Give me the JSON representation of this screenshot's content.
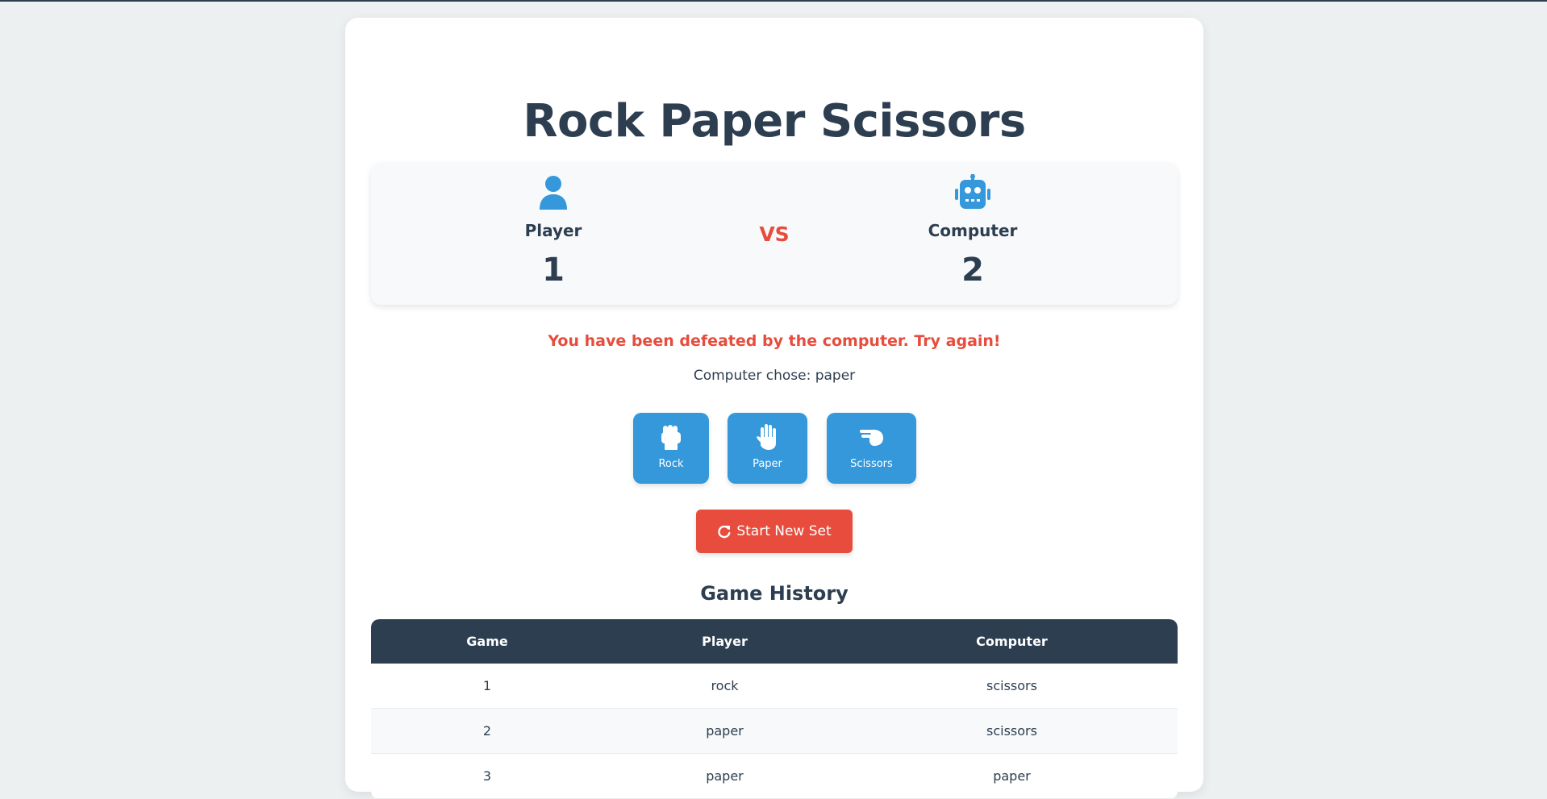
{
  "app": {
    "title": "Rock Paper Scissors"
  },
  "scoreboard": {
    "player": {
      "name": "Player",
      "score": "1",
      "icon": "user-icon"
    },
    "vs": "VS",
    "computer": {
      "name": "Computer",
      "score": "2",
      "icon": "robot-icon"
    }
  },
  "result": {
    "message": "You have been defeated by the computer. Try again!",
    "computer_choice": "Computer chose: paper"
  },
  "choices": [
    {
      "label": "Rock",
      "icon": "fist-icon"
    },
    {
      "label": "Paper",
      "icon": "hand-icon"
    },
    {
      "label": "Scissors",
      "icon": "scissors-hand-icon"
    }
  ],
  "new_set": {
    "label": "Start New Set",
    "icon": "refresh-icon"
  },
  "history": {
    "title": "Game History",
    "columns": [
      "Game",
      "Player",
      "Computer"
    ],
    "rows": [
      [
        "1",
        "rock",
        "scissors"
      ],
      [
        "2",
        "paper",
        "scissors"
      ],
      [
        "3",
        "paper",
        "paper"
      ]
    ]
  },
  "colors": {
    "accent": "#3498db",
    "danger": "#e74c3c",
    "dark": "#2c3e50",
    "background": "#ecf0f1"
  }
}
